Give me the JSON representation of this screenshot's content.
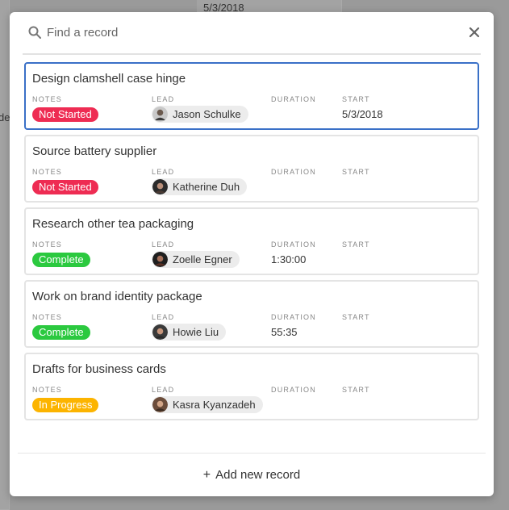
{
  "background": {
    "date_text": "5/3/2018",
    "partial_text": "de"
  },
  "search": {
    "placeholder": "Find a record"
  },
  "records": [
    {
      "title": "Design clamshell case hinge",
      "notes_label": "NOTES",
      "lead_label": "LEAD",
      "duration_label": "DURATION",
      "start_label": "START",
      "status": "Not Started",
      "status_color": "#ee2c53",
      "lead": "Jason Schulke",
      "duration": "",
      "start": "5/3/2018",
      "selected": true
    },
    {
      "title": "Source battery supplier",
      "notes_label": "NOTES",
      "lead_label": "LEAD",
      "duration_label": "DURATION",
      "start_label": "START",
      "status": "Not Started",
      "status_color": "#ee2c53",
      "lead": "Katherine Duh",
      "duration": "",
      "start": ""
    },
    {
      "title": "Research other tea packaging",
      "notes_label": "NOTES",
      "lead_label": "LEAD",
      "duration_label": "DURATION",
      "start_label": "START",
      "status": "Complete",
      "status_color": "#2bc93f",
      "lead": "Zoelle Egner",
      "duration": "1:30:00",
      "start": ""
    },
    {
      "title": "Work on brand identity package",
      "notes_label": "NOTES",
      "lead_label": "LEAD",
      "duration_label": "DURATION",
      "start_label": "START",
      "status": "Complete",
      "status_color": "#2bc93f",
      "lead": "Howie Liu",
      "duration": "55:35",
      "start": ""
    },
    {
      "title": "Drafts for business cards",
      "notes_label": "NOTES",
      "lead_label": "LEAD",
      "duration_label": "DURATION",
      "start_label": "START",
      "status": "In Progress",
      "status_color": "#fcb400",
      "lead": "Kasra Kyanzadeh",
      "duration": "",
      "start": ""
    }
  ],
  "footer": {
    "add_label": "Add new record"
  },
  "icons": {
    "search": "search-icon",
    "close": "close-icon",
    "plus": "plus-icon"
  }
}
